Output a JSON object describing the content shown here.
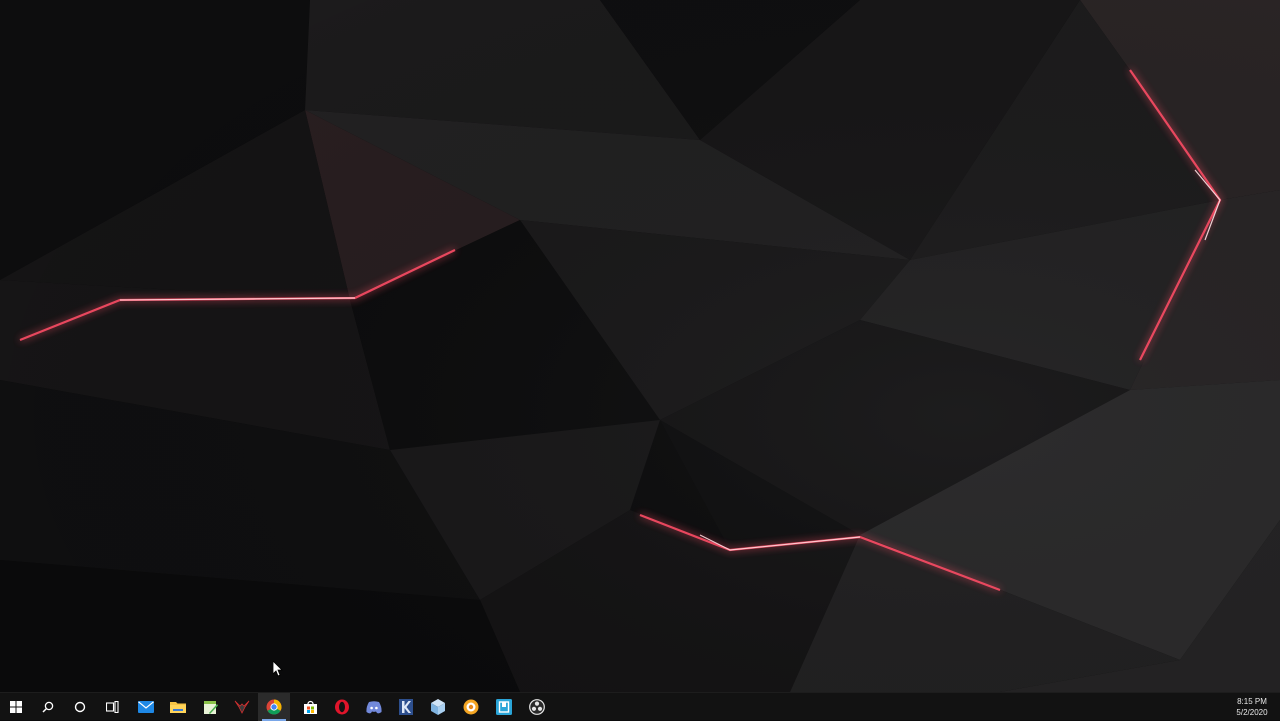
{
  "taskbar": {
    "start_icon": "windows-logo-icon",
    "search_icon": "search-icon",
    "cortana_icon": "cortana-circle-icon",
    "task_view_icon": "task-view-icon",
    "pinned_apps": [
      {
        "name": "mail",
        "icon": "mail-icon",
        "running": false
      },
      {
        "name": "file-explorer",
        "icon": "folder-icon",
        "running": false
      },
      {
        "name": "notepad-plus-plus",
        "icon": "notepad-plus-plus-icon",
        "running": false
      },
      {
        "name": "predator-sense",
        "icon": "predator-icon",
        "running": false
      },
      {
        "name": "google-chrome",
        "icon": "chrome-icon",
        "running": true,
        "active": true
      },
      {
        "name": "microsoft-store",
        "icon": "store-bag-icon",
        "running": false
      },
      {
        "name": "opera",
        "icon": "opera-icon",
        "running": false
      },
      {
        "name": "discord",
        "icon": "discord-icon",
        "running": false
      },
      {
        "name": "k-app",
        "icon": "k-app-icon",
        "running": false
      },
      {
        "name": "cube-app",
        "icon": "cube-icon",
        "running": false
      },
      {
        "name": "orange-circle-app",
        "icon": "orange-circle-icon",
        "running": false
      },
      {
        "name": "blue-square-app",
        "icon": "blue-square-icon",
        "running": false
      },
      {
        "name": "obs-studio",
        "icon": "obs-icon",
        "running": false
      }
    ],
    "clock": {
      "time": "8:15 PM",
      "date": "5/2/2020"
    }
  },
  "colors": {
    "wallpaper_dark": "#0b0b0c",
    "glow_red": "#ff4d66",
    "taskbar_bg": "#121212",
    "active_underline": "#79a6e8"
  }
}
